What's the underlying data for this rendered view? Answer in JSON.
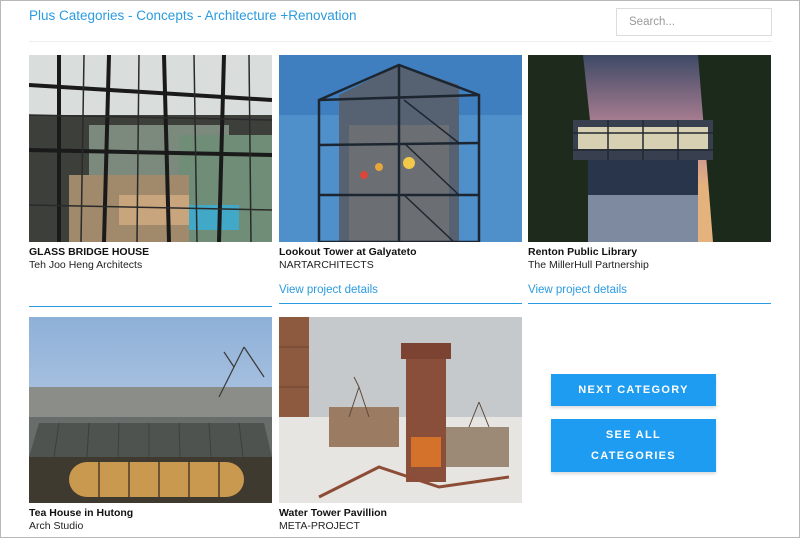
{
  "header": {
    "title": "Plus Categories - Concepts - Architecture +Renovation",
    "search_placeholder": "Search..."
  },
  "projects": [
    {
      "title": "GLASS BRIDGE HOUSE",
      "firm": "Teh Joo Heng Architects"
    },
    {
      "title": "Lookout Tower at Galyateto",
      "firm": "NARTARCHITECTS",
      "link": "View project details"
    },
    {
      "title": "Renton Public Library",
      "firm": "The MillerHull Partnership",
      "link": "View project details"
    },
    {
      "title": "Tea House in Hutong",
      "firm": "Arch Studio"
    },
    {
      "title": "Water Tower Pavillion",
      "firm": "META-PROJECT"
    }
  ],
  "buttons": {
    "next": "NEXT CATEGORY",
    "all": "SEE ALL CATEGORIES"
  },
  "colors": {
    "accent": "#2a9be0",
    "button": "#1e9cf2"
  }
}
